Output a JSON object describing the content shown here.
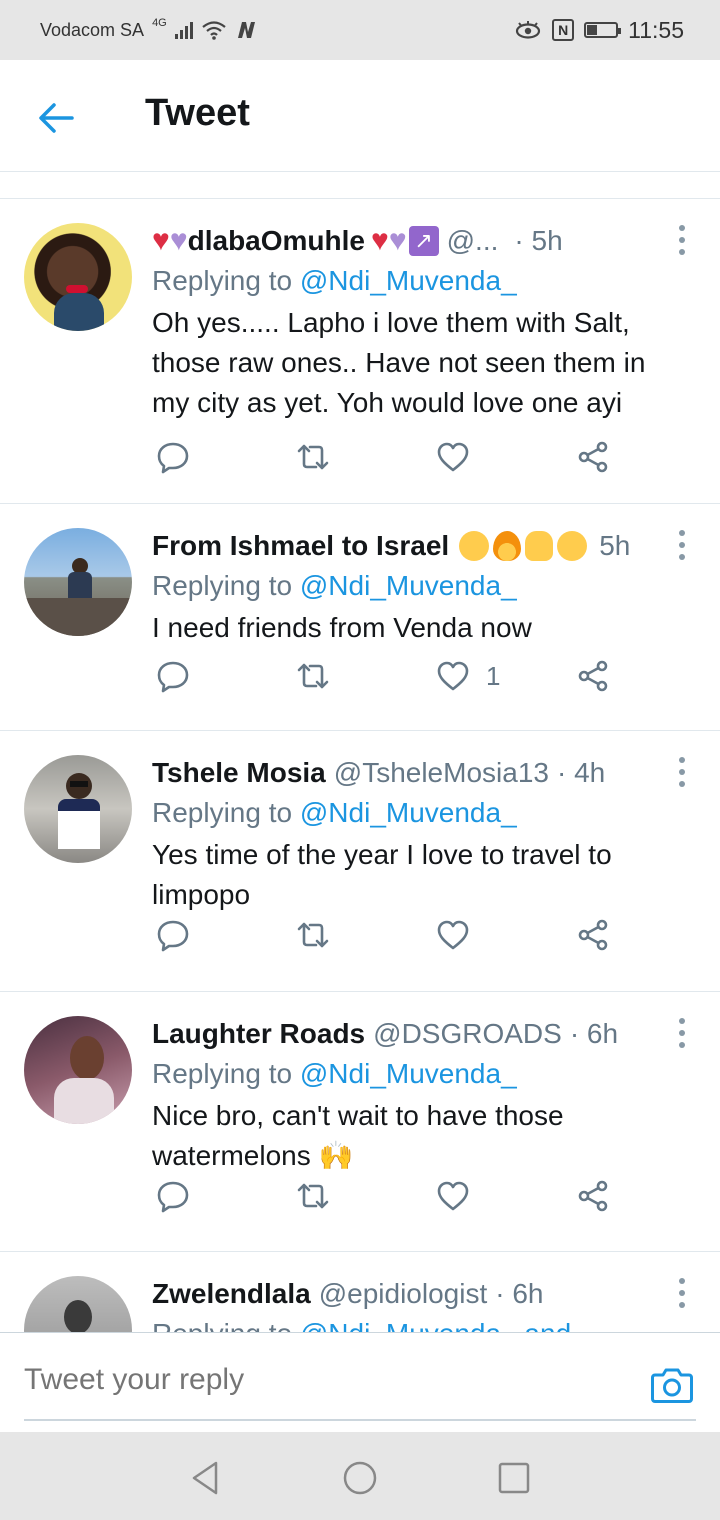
{
  "status_bar": {
    "carrier": "Vodacom SA",
    "network": "4G",
    "time": "11:55",
    "battery_level": 0.35
  },
  "header": {
    "title": "Tweet"
  },
  "tweets": [
    {
      "name": "dlabaOmuhle",
      "handle": "@...",
      "time": "· 5h",
      "replying_prefix": "Replying to ",
      "replying_to": "@Ndi_Muvenda_",
      "text": "Oh yes..... Lapho i love them with Salt, those raw ones.. Have not seen them in my city as yet.  Yoh would love one ayi",
      "like_count": ""
    },
    {
      "name": "From Ishmael to Israel",
      "handle": "",
      "time": "5h",
      "replying_prefix": "Replying to ",
      "replying_to": "@Ndi_Muvenda_",
      "text": "I need friends from Venda now",
      "like_count": "1"
    },
    {
      "name": "Tshele Mosia",
      "handle": "@TsheleMosia13",
      "time": "· 4h",
      "replying_prefix": "Replying to ",
      "replying_to": "@Ndi_Muvenda_",
      "text": "Yes time of the year I love to travel to limpopo",
      "like_count": ""
    },
    {
      "name": "Laughter Roads",
      "handle": "@DSGROADS",
      "time": "· 6h",
      "replying_prefix": "Replying to ",
      "replying_to": "@Ndi_Muvenda_",
      "text": "Nice bro, can't wait to have those watermelons 🙌",
      "like_count": ""
    },
    {
      "name": "Zwelendlala",
      "handle": "@epidiologist",
      "time": "· 6h",
      "replying_prefix": "Replying to ",
      "replying_to": "@Ndi_Muvenda_ and",
      "text": "",
      "like_count": ""
    }
  ],
  "reply_bar": {
    "placeholder": "Tweet your reply"
  },
  "colors": {
    "accent": "#1b95e0",
    "secondary_text": "#657786",
    "divider": "#e1e8ed"
  }
}
